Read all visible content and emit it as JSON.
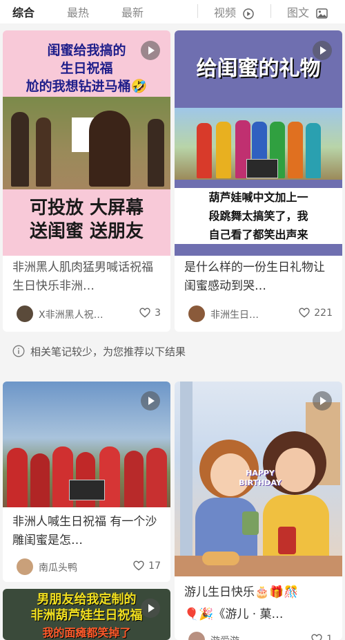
{
  "tabs": {
    "all": "综合",
    "hot": "最热",
    "new": "最新",
    "video": "视频",
    "image": "图文"
  },
  "cards": [
    {
      "title": "非洲黑人肌肉猛男喊话祝福生日快乐非洲…",
      "author": "X非洲黑人祝…",
      "likes": "3",
      "cover_text_top": [
        "闺蜜给我搞的",
        "生日祝福",
        "尬的我想钻进马桶🤣"
      ],
      "cover_text_bottom": [
        "可投放 大屏幕",
        "送闺蜜 送朋友"
      ]
    },
    {
      "title": "是什么样的一份生日礼物让闺蜜感动到哭…",
      "author": "非洲生日…",
      "likes": "221",
      "cover_text_top": "给闺蜜的礼物",
      "cover_text_bottom": [
        "葫芦娃喊中文加上一",
        "段跳舞太搞笑了，我",
        "自己看了都笑出声来"
      ]
    },
    {
      "title": "非洲人喊生日祝福 有一个沙雕闺蜜是怎…",
      "author": "南瓜头鸭",
      "likes": "17"
    },
    {
      "title": "游儿生日快乐🎂🎁🎊",
      "title2": "🎈🎉《游儿 · 菓…",
      "author": "游爱游",
      "likes": "1",
      "cover_text": "HAPPY BIRTHDAY"
    },
    {
      "cover_text_top": [
        "男朋友给我定制的",
        "非洲葫芦娃生日祝福"
      ],
      "cover_text_bottom": "我的面瘫都笑掉了"
    }
  ],
  "banner": {
    "text": "相关笔记较少，为您推荐以下结果"
  },
  "colors": {
    "active_tab": "#222222",
    "inactive_tab": "#888888",
    "heart": "#666666"
  }
}
